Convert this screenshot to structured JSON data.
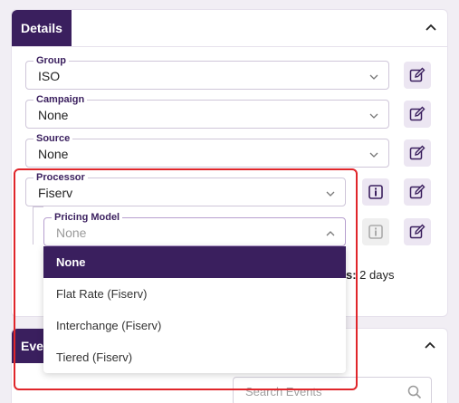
{
  "details": {
    "title": "Details",
    "fields": [
      {
        "label": "Group",
        "value": "ISO"
      },
      {
        "label": "Campaign",
        "value": "None"
      },
      {
        "label": "Source",
        "value": "None"
      },
      {
        "label": "Processor",
        "value": "Fiserv"
      }
    ],
    "pricing_model": {
      "label": "Pricing Model",
      "placeholder": "None"
    },
    "tail_bold": "s:",
    "tail_value": " 2 days"
  },
  "dropdown": {
    "options": [
      "None",
      "Flat Rate (Fiserv)",
      "Interchange (Fiserv)",
      "Tiered (Fiserv)"
    ],
    "selected": "None"
  },
  "events": {
    "title": "Events",
    "search_placeholder": "Search Events"
  },
  "colors": {
    "accent": "#3a1f5e",
    "highlight": "#e0262b"
  }
}
